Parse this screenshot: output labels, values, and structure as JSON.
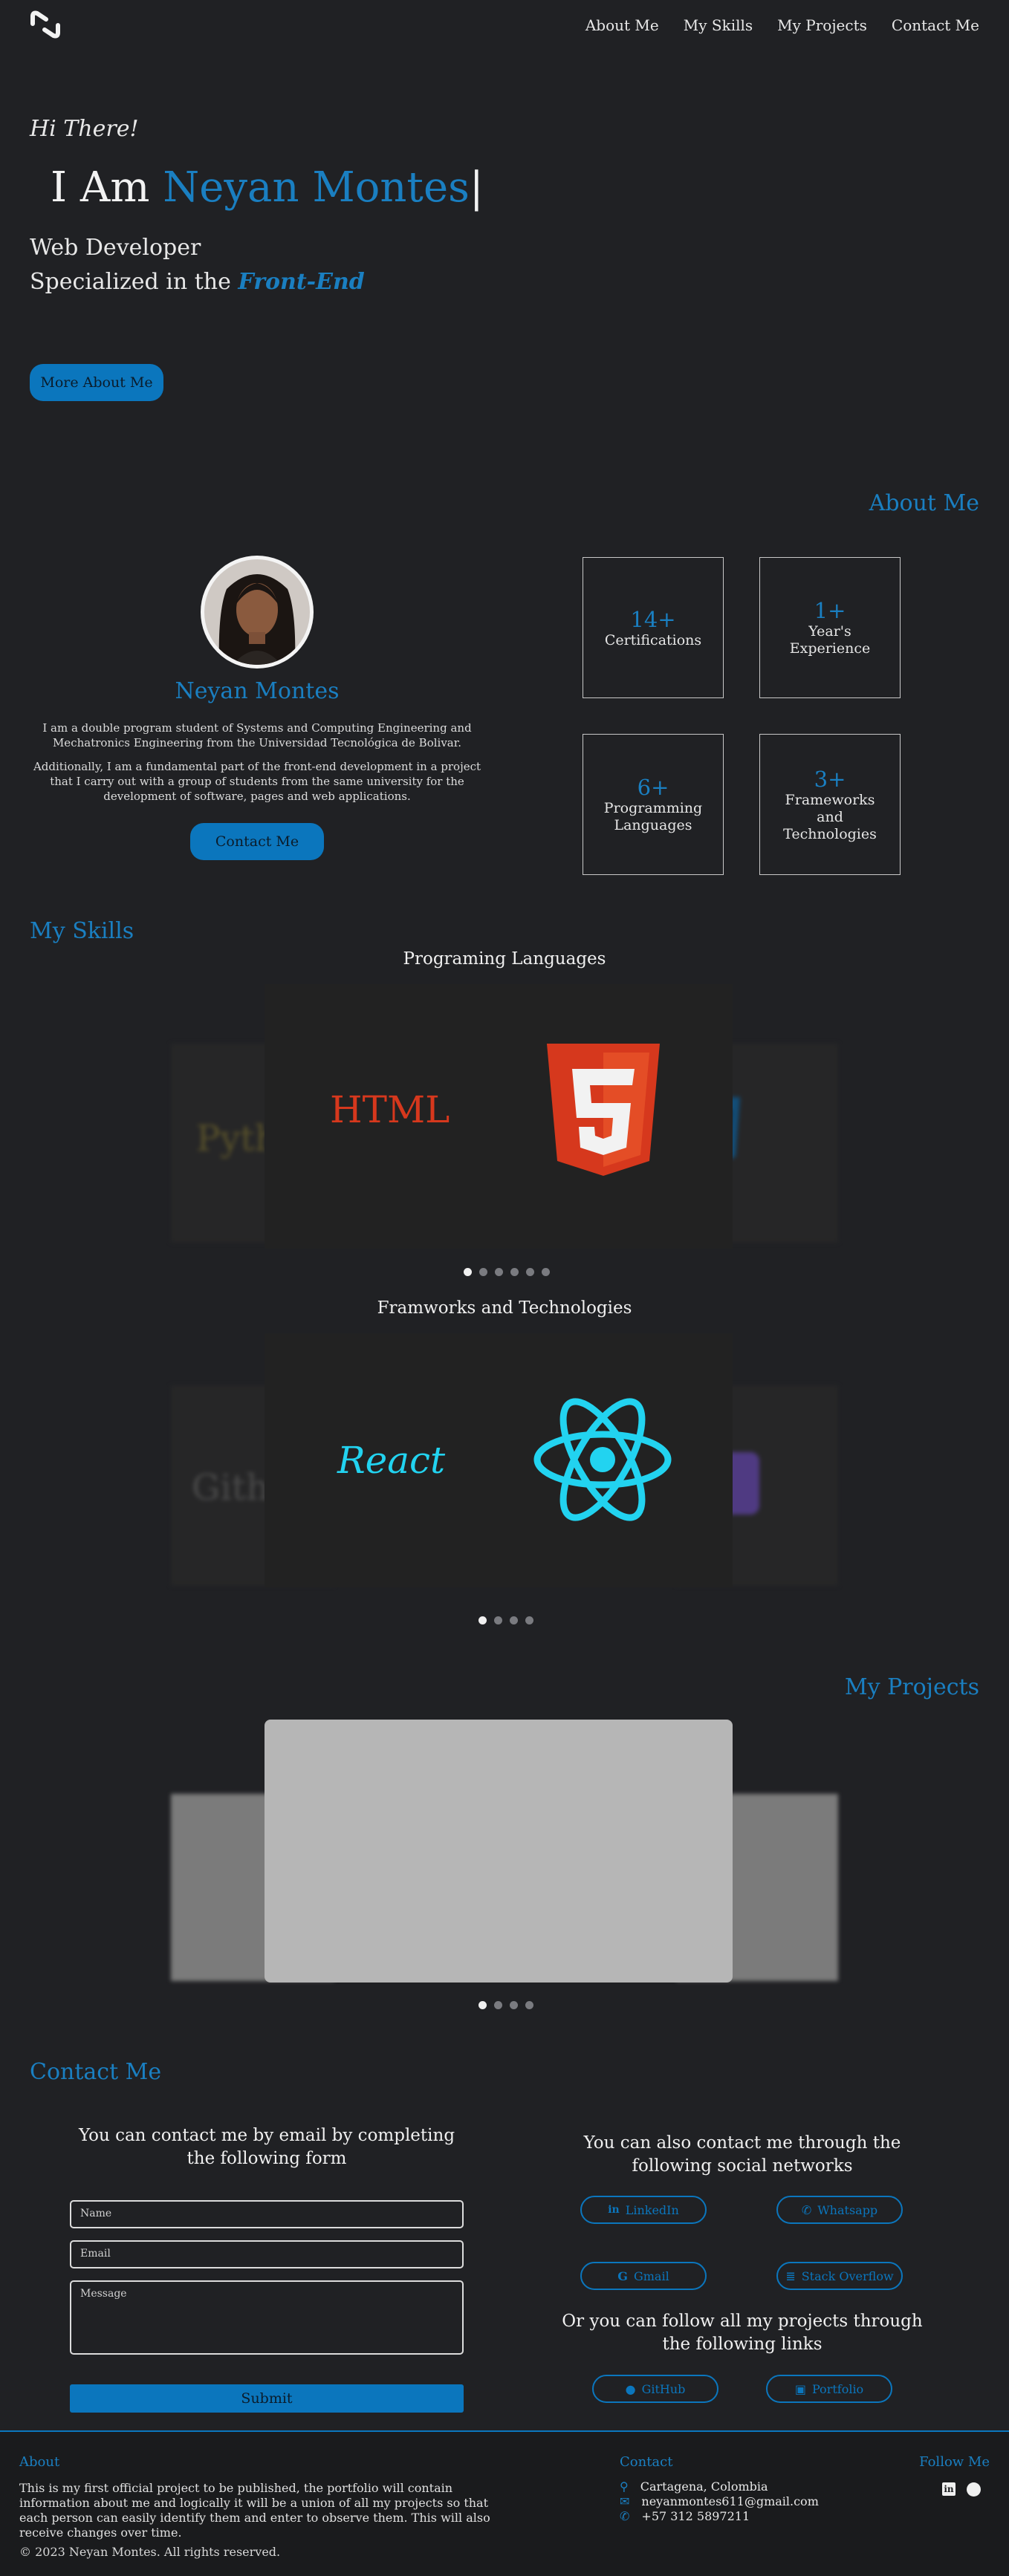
{
  "nav": {
    "logo_icon": "nz-monogram-logo",
    "links": [
      "About Me",
      "My Skills",
      "My Projects",
      "Contact Me"
    ]
  },
  "hero": {
    "greeting": "Hi There!",
    "iam": "I Am",
    "name": "Neyan Montes",
    "cursor": "|",
    "role": "Web Developer",
    "specialized": "Specialized in the",
    "specialty": "Front-End",
    "button": "More About Me"
  },
  "about": {
    "heading": "About Me",
    "name": "Neyan Montes",
    "para1": "I am a double program student of Systems and Computing Engineering and Mechatronics Engineering from the Universidad Tecnológica de Bolivar.",
    "para2": "Additionally, I am a fundamental part of the front-end development in a project that I carry out with a group of students from the same university for the development of software, pages and web applications.",
    "button": "Contact Me",
    "stats": [
      {
        "value": "14+",
        "label": "Certifications"
      },
      {
        "value": "1+",
        "label": "Year's Experience"
      },
      {
        "value": "6+",
        "label": "Programming Languages"
      },
      {
        "value": "3+",
        "label": "Frameworks and Technologies"
      }
    ]
  },
  "skills": {
    "heading": "My Skills",
    "languages_title": "Programing Languages",
    "languages_active": "HTML",
    "languages_left_peek": "Pyth",
    "frameworks_title": "Framworks and Technologies",
    "frameworks_active": "React",
    "frameworks_left_peek": "Gith"
  },
  "projects": {
    "heading": "My Projects"
  },
  "contact": {
    "heading": "Contact Me",
    "form_title": "You can contact me by email by completing the following form",
    "name_placeholder": "Name",
    "email_placeholder": "Email",
    "message_placeholder": "Message",
    "submit": "Submit",
    "social_title": "You can also contact me through the following social networks",
    "socials": [
      "LinkedIn",
      "Whatsapp",
      "Gmail",
      "Stack Overflow"
    ],
    "follow_title": "Or you can follow all my projects through the following links",
    "links": [
      "GitHub",
      "Portfolio"
    ]
  },
  "footer": {
    "about_heading": "About",
    "about_text": "This is my first official project to be published, the portfolio will contain information about me and logically it will be a union of all my projects so that each person can easily identify them and enter to observe them. This will also receive changes over time.",
    "contact_heading": "Contact",
    "location": "Cartagena, Colombia",
    "email": "neyanmontes611@gmail.com",
    "phone": "+57 312 5897211",
    "follow_heading": "Follow Me",
    "copyright": "© 2023 Neyan Montes. All rights reserved."
  },
  "colors": {
    "background": "#202124",
    "accent": "#0b76bd",
    "html_orange": "#e44d26",
    "react_cyan": "#22d3f0"
  }
}
